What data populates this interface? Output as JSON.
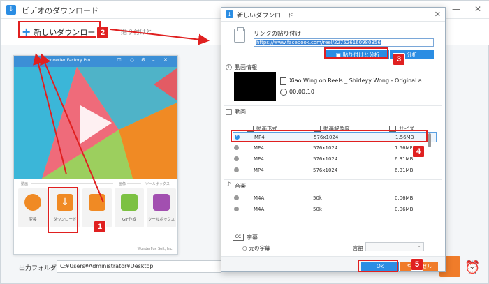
{
  "main_window": {
    "title": "ビデオのダウンロード",
    "new_download": "新しいダウンロード",
    "paste_url_bg": "貼り付けと",
    "output_folder_label": "出力フォルダ：",
    "output_folder_path": "C:¥Users¥Administrator¥Desktop",
    "minimize": "—",
    "close": "✕"
  },
  "thumbnail": {
    "app_name": "Converter Factory Pro",
    "section_video": "動画",
    "section_image": "画像",
    "section_toolbox": "ツールボックス",
    "tiles": [
      {
        "label": "変換",
        "color": "#f08a24"
      },
      {
        "label": "ダウンロード",
        "color": "#f08a24"
      },
      {
        "label": "",
        "color": "#f08a24"
      },
      {
        "label": "GIF作成",
        "color": "#7cc142"
      },
      {
        "label": "ツールボックス",
        "color": "#a24fb0"
      }
    ],
    "footer": "WonderFox Soft, Inc."
  },
  "dialog": {
    "title": "新しいダウンロード",
    "paste_url_label": "リンクの貼り付け",
    "url_value": "https://www.facebook.com/reel/227526160980356",
    "paste_analyze_label": "貼り付けと分析",
    "analyze_label": "分析",
    "video_info_label": "動画情報",
    "video_title": "Xiao Wing on Reels _ Shirleyy Wong - Original a...",
    "video_duration": "00:00:10",
    "video_section_label": "動画",
    "columns": {
      "format": "動画形式",
      "resolution": "動画解像度",
      "size": "サイズ"
    },
    "video_rows": [
      {
        "format": "MP4",
        "resolution": "576x1024",
        "size": "1.56MB",
        "selected": true
      },
      {
        "format": "MP4",
        "resolution": "576x1024",
        "size": "1.56MB",
        "selected": false
      },
      {
        "format": "MP4",
        "resolution": "576x1024",
        "size": "6.31MB",
        "selected": false
      },
      {
        "format": "MP4",
        "resolution": "576x1024",
        "size": "6.31MB",
        "selected": false
      }
    ],
    "audio_section_label": "音楽",
    "audio_rows": [
      {
        "format": "M4A",
        "resolution": "50k",
        "size": "0.06MB"
      },
      {
        "format": "M4A",
        "resolution": "50k",
        "size": "0.06MB"
      }
    ],
    "subtitle_section_label": "字幕",
    "subtitle_icon_text": "CC",
    "original_subtitle": "元の字幕",
    "language_label": "言語",
    "ok_label": "Ok",
    "cancel_label": "キャンセル"
  },
  "annotations": [
    "1",
    "2",
    "3",
    "4",
    "5"
  ],
  "colors": {
    "accent": "#2b8de3",
    "annotation": "#e02020",
    "cancel": "#f07c2a"
  }
}
